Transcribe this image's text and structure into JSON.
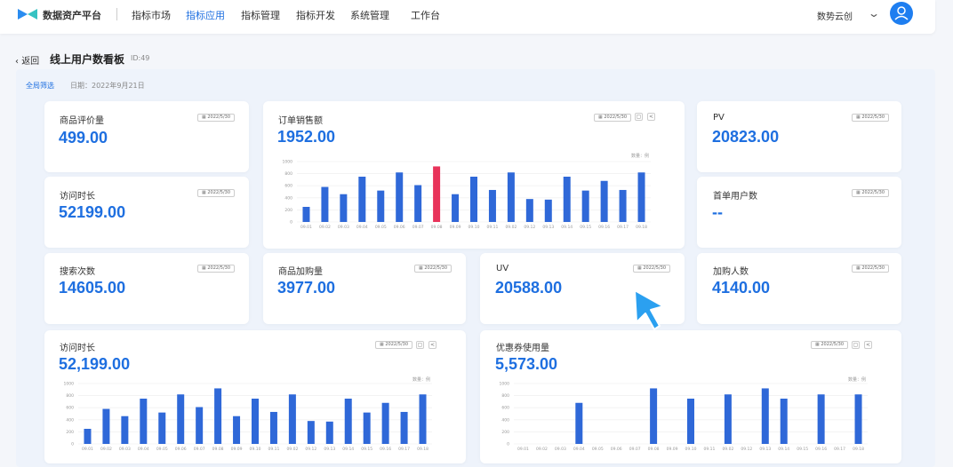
{
  "header": {
    "app_title": "数据资产平台",
    "nav": [
      "指标市场",
      "指标应用",
      "指标管理",
      "指标开发",
      "系统管理",
      "工作台"
    ],
    "active_nav": "指标应用",
    "org": "数势云创"
  },
  "page": {
    "back": "返回",
    "title": "线上用户数看板",
    "id": "ID:49",
    "filter_label": "全局筛选",
    "date_label": "日期：2022年9月21日"
  },
  "colors": {
    "accent": "#1e6fe0",
    "bar": "#2f68d8",
    "highlight": "#e8335a"
  },
  "cards": {
    "rating": {
      "title": "商品评价量",
      "value": "499.00",
      "date": "2022/5/30"
    },
    "visit": {
      "title": "访问时长",
      "value": "52199.00",
      "date": "2022/5/30"
    },
    "pv": {
      "title": "PV",
      "value": "20823.00",
      "date": "2022/5/30"
    },
    "first_order": {
      "title": "首单用户数",
      "value": "--",
      "date": "2022/5/30"
    },
    "search": {
      "title": "搜索次数",
      "value": "14605.00",
      "date": "2022/5/30"
    },
    "cart": {
      "title": "商品加购量",
      "value": "3977.00",
      "date": "2022/5/30"
    },
    "uv": {
      "title": "UV",
      "value": "20588.00",
      "date": "2022/5/30"
    },
    "cart_users": {
      "title": "加购人数",
      "value": "4140.00",
      "date": "2022/5/30"
    },
    "sales": {
      "title": "订单销售额",
      "value": "1952.00",
      "date": "2022/5/30",
      "unit": "数量：例"
    },
    "visit2": {
      "title": "访问时长",
      "value": "52,199.00",
      "date": "2022/5/30",
      "unit": "数量：例"
    },
    "coupon": {
      "title": "优惠券使用量",
      "value": "5,573.00",
      "date": "2022/5/30",
      "unit": "数量：例"
    }
  },
  "chart_data": [
    {
      "type": "bar",
      "name": "订单销售额",
      "categories": [
        "09.01",
        "09.02",
        "09.03",
        "09.04",
        "09.05",
        "09.06",
        "09.07",
        "09.08",
        "09.09",
        "09.10",
        "09.11",
        "09.12",
        "09.13",
        "09.14",
        "09.15",
        "09.16",
        "09.17",
        "09.18"
      ],
      "x_ticks": [
        "09.01",
        "09.02",
        "09.03",
        "09.04",
        "09.05",
        "09.06",
        "09.07",
        "09.08",
        "09.09",
        "09.10",
        "09.11",
        "09.02",
        "09.12",
        "09.13",
        "09.14",
        "09.15",
        "09.16",
        "09.17",
        "09.18"
      ],
      "values": [
        250,
        580,
        460,
        750,
        520,
        820,
        610,
        920,
        460,
        750,
        530,
        820,
        380,
        370,
        750,
        520,
        680,
        530,
        820
      ],
      "highlight_index": 7,
      "ylim": [
        0,
        1000
      ],
      "y_ticks": [
        0,
        200,
        400,
        600,
        800,
        1000
      ]
    },
    {
      "type": "bar",
      "name": "访问时长",
      "x_ticks": [
        "09.01",
        "09.02",
        "09.03",
        "09.04",
        "09.05",
        "09.06",
        "09.07",
        "09.08",
        "09.09",
        "09.10",
        "09.11",
        "09.02",
        "09.12",
        "09.13",
        "09.14",
        "09.15",
        "09.16",
        "09.17",
        "09.18"
      ],
      "values": [
        250,
        580,
        460,
        750,
        520,
        820,
        610,
        920,
        460,
        750,
        530,
        820,
        380,
        370,
        750,
        520,
        680,
        530,
        820
      ],
      "ylim": [
        0,
        1000
      ],
      "y_ticks": [
        0,
        200,
        400,
        600,
        800,
        1000
      ]
    },
    {
      "type": "bar",
      "name": "优惠券使用量",
      "x_ticks": [
        "09.01",
        "09.02",
        "09.03",
        "09.04",
        "09.05",
        "09.06",
        "09.07",
        "09.08",
        "09.09",
        "09.10",
        "09.11",
        "09.02",
        "09.12",
        "09.13",
        "09.14",
        "09.15",
        "09.16",
        "09.17",
        "09.18"
      ],
      "values": [
        0,
        0,
        0,
        680,
        0,
        0,
        0,
        920,
        0,
        750,
        0,
        820,
        0,
        920,
        750,
        0,
        820,
        0,
        820
      ],
      "ylim": [
        0,
        1000
      ],
      "y_ticks": [
        0,
        200,
        400,
        600,
        800,
        1000
      ]
    }
  ]
}
